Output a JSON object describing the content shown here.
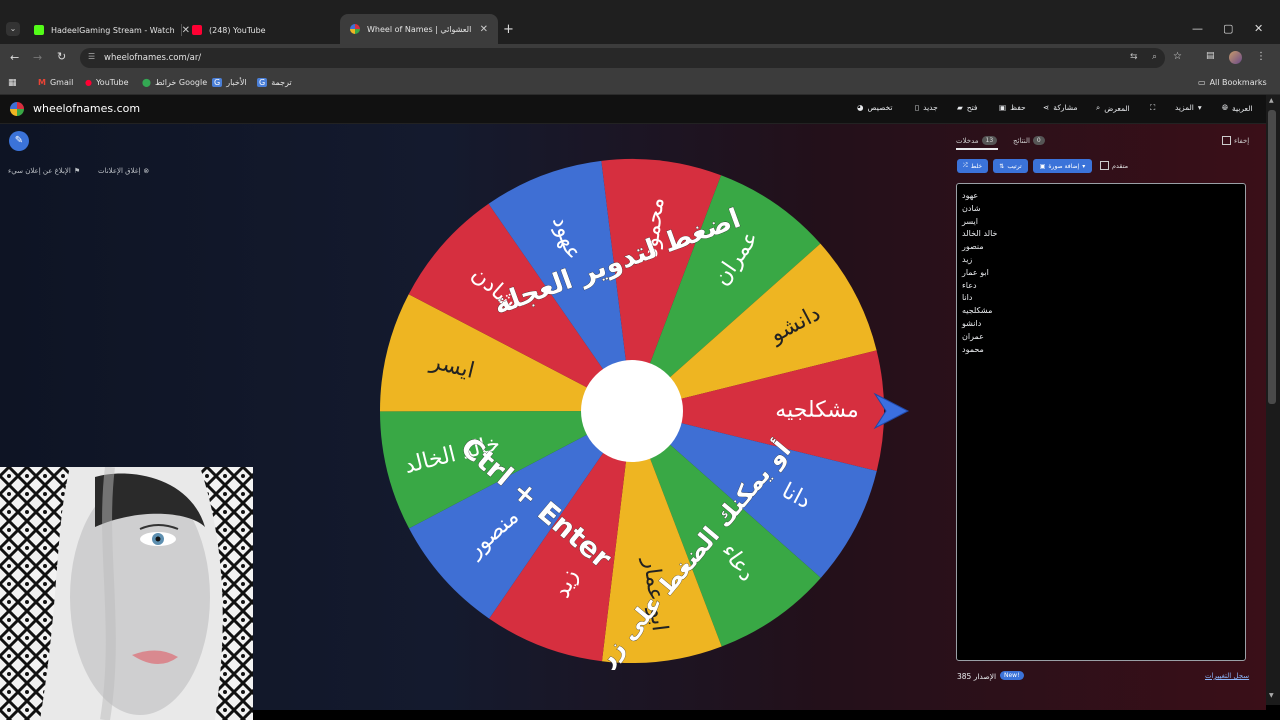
{
  "browser": {
    "tabs": [
      {
        "title": "HadeelGaming Stream - Watch",
        "favicon_color": "#53fc18"
      },
      {
        "title": "(248) YouTube",
        "favicon_color": "#ff0033"
      },
      {
        "title": "Wheel of Names | اسم العشوائي",
        "favicon_color": "#34a853"
      }
    ],
    "url": "wheelofnames.com/ar/",
    "bookmarks": [
      "Gmail",
      "YouTube",
      "خرائط Google",
      "الأخبار",
      "ترجمة"
    ],
    "all_bookmarks": "All Bookmarks"
  },
  "site": {
    "logo": "wheelofnames.com",
    "menu": [
      "العربية",
      "المزيد",
      "المعرض",
      "مشاركة",
      "حفظ",
      "فتح",
      "جديد",
      "تخصيص"
    ],
    "ad_report": "الإبلاغ عن إعلان سيء",
    "ad_close": "إغلاق الإعلانات"
  },
  "wheel": {
    "names": [
      "محمود",
      "عمران",
      "دانشو",
      "مشكلجيه",
      "دانا",
      "دعاء",
      "ابو عمار",
      "زيد",
      "منصور",
      "خالد الخالد",
      "ايسر",
      "شادن",
      "عهود"
    ],
    "colors": [
      "#d62f3f",
      "#39a845",
      "#eeb522",
      "#d62f3f",
      "#3f6fd4",
      "#39a845",
      "#eeb522",
      "#d62f3f",
      "#3f6fd4",
      "#39a845",
      "#eeb522",
      "#d62f3f",
      "#3f6fd4"
    ],
    "instruction_line1": "اضغط لتدوير العجلة",
    "instruction_line2": "أو يمكنك الضغط على زر",
    "instruction_line3": "Ctrl + Enter"
  },
  "panel": {
    "tab_entries": "مدخلات",
    "entries_count": "13",
    "tab_results": "النتائج",
    "results_count": "0",
    "hide_label": "إخفاء",
    "shuffle": "خلط",
    "sort": "ترتيب",
    "add_image": "إضافة صورة",
    "advanced": "متقدم",
    "entries": [
      "عهود",
      "شادن",
      "ايسر",
      "خالد الخالد",
      "منصور",
      "زيد",
      "ابو عمار",
      "دعاء",
      "دانا",
      "مشكلجيه",
      "دانشو",
      "عمران",
      "محمود"
    ],
    "version": "الإصدار 385",
    "new_badge": "New!",
    "changelog": "سجل التغييرات"
  }
}
